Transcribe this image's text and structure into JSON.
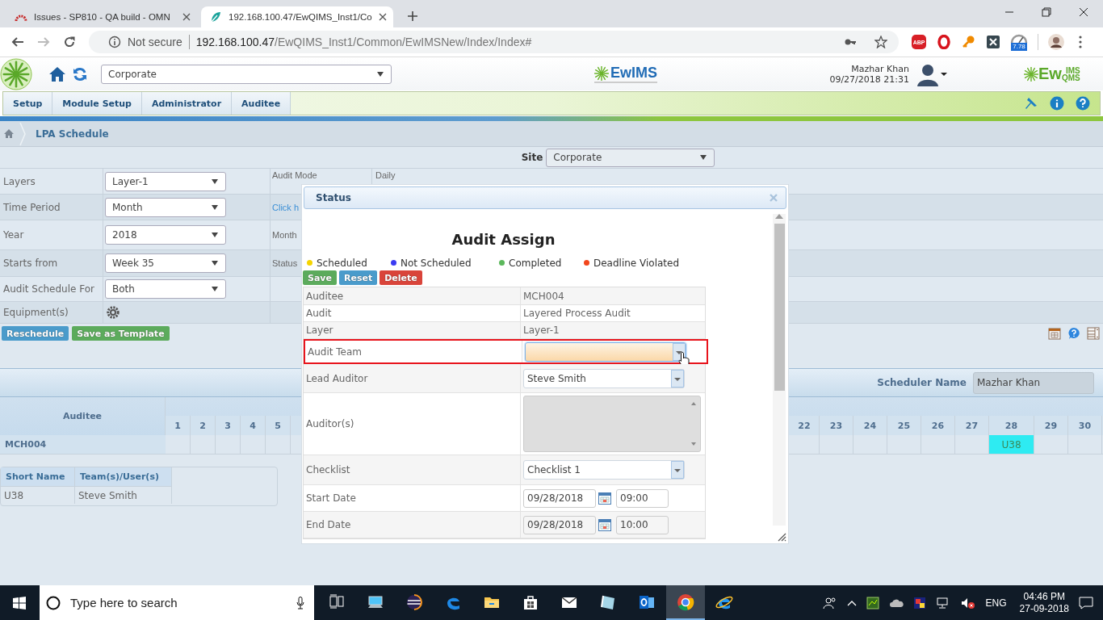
{
  "browser": {
    "tabs": [
      {
        "title": "Issues - SP810 - QA build - OMN",
        "selected": false
      },
      {
        "title": "192.168.100.47/EwQIMS_Inst1/Co",
        "selected": true
      }
    ],
    "security": "Not secure",
    "url_host": "192.168.100.47",
    "url_path": "/EwQIMS_Inst1/Common/EwIMSNew/Index/Index#",
    "extensions": [
      {
        "kind": "abp",
        "badge": "ABP"
      },
      {
        "kind": "opera"
      },
      {
        "kind": "key"
      },
      {
        "kind": "x"
      },
      {
        "kind": "gauge",
        "badge": "7.78"
      }
    ]
  },
  "app_header": {
    "site_select": "Corporate",
    "logo_center": "EwIMS",
    "user_name": "Mazhar Khan",
    "login_time": "09/27/2018 21:31",
    "logo_right": {
      "prefix": "Ew",
      "top": "IMS",
      "bottom": "QMS"
    }
  },
  "menu": [
    {
      "label": "Setup"
    },
    {
      "label": "Module Setup"
    },
    {
      "label": "Administrator"
    },
    {
      "label": "Auditee"
    }
  ],
  "breadcrumb": "LPA Schedule",
  "site": {
    "label": "Site",
    "value": "Corporate"
  },
  "form_rows": [
    {
      "label": "Layers",
      "kind": "select",
      "value": "Layer-1",
      "aside_label": "Audit Mode",
      "aside_value": "Daily"
    },
    {
      "label": "Time Period",
      "kind": "select",
      "value": "Month",
      "aside_link": "Click h"
    },
    {
      "label": "Year",
      "kind": "select",
      "value": "2018",
      "aside_label": "Month"
    },
    {
      "label": "Starts from",
      "kind": "select",
      "value": "Week 35",
      "aside_label": "Status"
    },
    {
      "label": "Audit Schedule For",
      "kind": "select",
      "value": "Both"
    },
    {
      "label": "Equipment(s)",
      "kind": "gear"
    }
  ],
  "actions": [
    {
      "label": "Reschedule",
      "kind": "info"
    },
    {
      "label": "Save as Template",
      "kind": "success"
    }
  ],
  "scheduler": {
    "label": "Scheduler Name",
    "value": "Mazhar Khan"
  },
  "calendar": {
    "header": "Auditee",
    "row_label": "MCH004",
    "days_before": [
      {
        "label": "1"
      },
      {
        "label": "2"
      },
      {
        "label": "3"
      },
      {
        "label": "4"
      },
      {
        "label": "5"
      }
    ],
    "days_after": [
      {
        "label": "22"
      },
      {
        "label": "23"
      },
      {
        "label": "24"
      },
      {
        "label": "25"
      },
      {
        "label": "26"
      },
      {
        "label": "27"
      },
      {
        "label": "28",
        "entry": "U38",
        "color": "#2eebf2"
      },
      {
        "label": "29"
      },
      {
        "label": "30"
      }
    ]
  },
  "legend_table": {
    "columns": [
      "Short Name",
      "Team(s)/User(s)"
    ],
    "rows": [
      [
        "U38",
        "Steve Smith"
      ]
    ]
  },
  "dialog": {
    "title": "Status",
    "heading": "Audit Assign",
    "statuses": [
      {
        "label": "Scheduled",
        "color": "#f5d400"
      },
      {
        "label": "Not Scheduled",
        "color": "#3b3bf2"
      },
      {
        "label": "Completed",
        "color": "#5cb85c"
      },
      {
        "label": "Deadline Violated",
        "color": "#f2461c"
      }
    ],
    "buttons": [
      {
        "label": "Save",
        "kind": "success"
      },
      {
        "label": "Reset",
        "kind": "info"
      },
      {
        "label": "Delete",
        "kind": "danger"
      }
    ],
    "rows": [
      {
        "label": "Auditee",
        "kind": "text",
        "value": "MCH004"
      },
      {
        "label": "Audit",
        "kind": "text",
        "value": "Layered Process Audit"
      },
      {
        "label": "Layer",
        "kind": "text",
        "value": "Layer-1"
      },
      {
        "label": "Audit Team",
        "kind": "combo",
        "highlighted": true,
        "focused": true
      },
      {
        "label": "Lead Auditor",
        "kind": "combo",
        "value": "Steve Smith",
        "highlighted": false,
        "focused": false
      },
      {
        "label": "Auditor(s)",
        "kind": "listbox",
        "disabled": true
      },
      {
        "label": "Checklist",
        "kind": "combo",
        "value": "Checklist 1",
        "highlighted": false,
        "focused": false
      },
      {
        "label": "Start Date",
        "kind": "datetime",
        "date": "09/28/2018",
        "time": "09:00"
      },
      {
        "label": "End Date",
        "kind": "datetime",
        "date": "09/28/2018",
        "time": "10:00"
      }
    ]
  },
  "taskbar": {
    "search_placeholder": "Type here to search",
    "apps": [
      {
        "kind": "taskview",
        "selected": false
      },
      {
        "kind": "computer",
        "selected": false
      },
      {
        "kind": "eclipse",
        "selected": false
      },
      {
        "kind": "edge",
        "selected": false
      },
      {
        "kind": "folder",
        "selected": false
      },
      {
        "kind": "store",
        "selected": false
      },
      {
        "kind": "mail",
        "selected": false
      },
      {
        "kind": "notebook",
        "selected": false
      },
      {
        "kind": "outlook",
        "selected": false
      },
      {
        "kind": "chrome",
        "selected": true
      },
      {
        "kind": "ie",
        "selected": false
      }
    ],
    "language": "ENG",
    "time": "04:46 PM",
    "date": "27-09-2018"
  }
}
